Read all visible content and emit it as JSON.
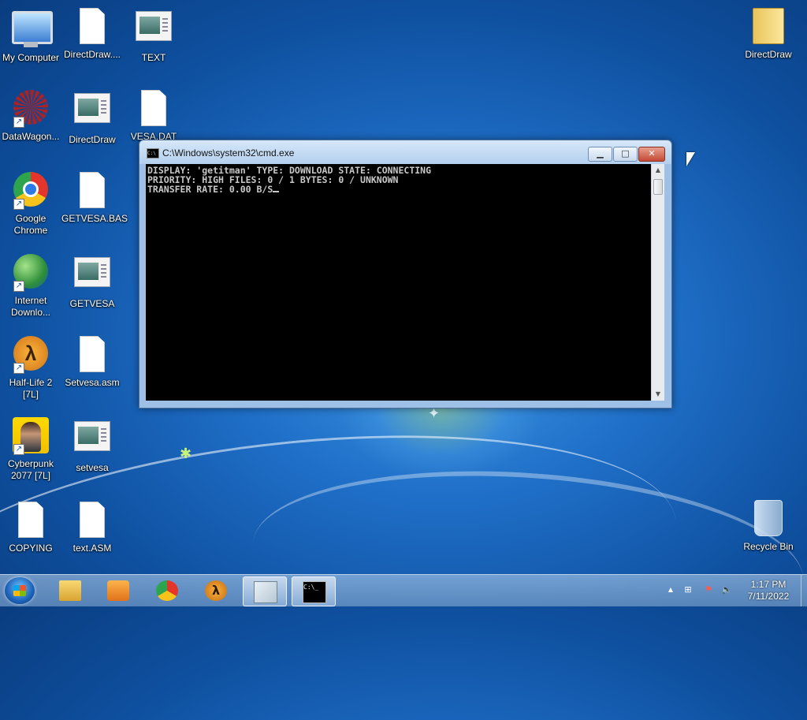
{
  "desktop": {
    "icons": [
      {
        "label": "My Computer",
        "icon": "computer-icon"
      },
      {
        "label": "DirectDraw....",
        "icon": "document-icon"
      },
      {
        "label": "TEXT",
        "icon": "application-icon"
      },
      {
        "label": "DataWagon...",
        "icon": "datawagon-icon"
      },
      {
        "label": "DirectDraw",
        "icon": "application-icon"
      },
      {
        "label": "VESA.DAT",
        "icon": "document-icon"
      },
      {
        "label": "Google Chrome",
        "icon": "chrome-icon"
      },
      {
        "label": "GETVESA.BAS",
        "icon": "document-icon"
      },
      {
        "label": "Internet Downlo...",
        "icon": "internet-download-manager-icon"
      },
      {
        "label": "GETVESA",
        "icon": "application-icon"
      },
      {
        "label": "Half-Life 2 [7L]",
        "icon": "half-life-icon"
      },
      {
        "label": "Setvesa.asm",
        "icon": "document-icon"
      },
      {
        "label": "Cyberpunk 2077 [7L]",
        "icon": "cyberpunk-icon"
      },
      {
        "label": "setvesa",
        "icon": "application-icon"
      },
      {
        "label": "COPYING",
        "icon": "document-icon"
      },
      {
        "label": "text.ASM",
        "icon": "document-icon"
      },
      {
        "label": "DirectDraw",
        "icon": "folder-icon"
      },
      {
        "label": "Recycle Bin",
        "icon": "recycle-bin-icon"
      }
    ]
  },
  "cmd_window": {
    "title": "C:\\Windows\\system32\\cmd.exe",
    "icon_text": "C:\\",
    "min_glyph": "▁",
    "max_glyph": "□",
    "close_glyph": "✕",
    "lines": [
      "DISPLAY: 'getitman' TYPE: DOWNLOAD STATE: CONNECTING",
      "PRIORITY: HIGH FILES: 0 / 1 BYTES: 0 / UNKNOWN",
      "TRANSFER RATE: 0.00 B/S"
    ],
    "scroll_up": "▲",
    "scroll_down": "▼"
  },
  "taskbar": {
    "pinned": [
      {
        "name": "windows-explorer",
        "icon": "folder-icon"
      },
      {
        "name": "media-player",
        "icon": "media-player-icon"
      },
      {
        "name": "google-chrome",
        "icon": "chrome-icon"
      },
      {
        "name": "half-life-2",
        "icon": "half-life-icon",
        "glyph": "λ"
      },
      {
        "name": "notepad",
        "icon": "notepad-icon"
      },
      {
        "name": "command-prompt",
        "icon": "terminal-icon",
        "glyph": "C:\\_"
      }
    ],
    "tray": {
      "expand_glyph": "▲",
      "clock_time": "1:17 PM",
      "clock_date": "7/11/2022"
    }
  },
  "wallpaper": {
    "primary_color": "#1f6fc8"
  }
}
